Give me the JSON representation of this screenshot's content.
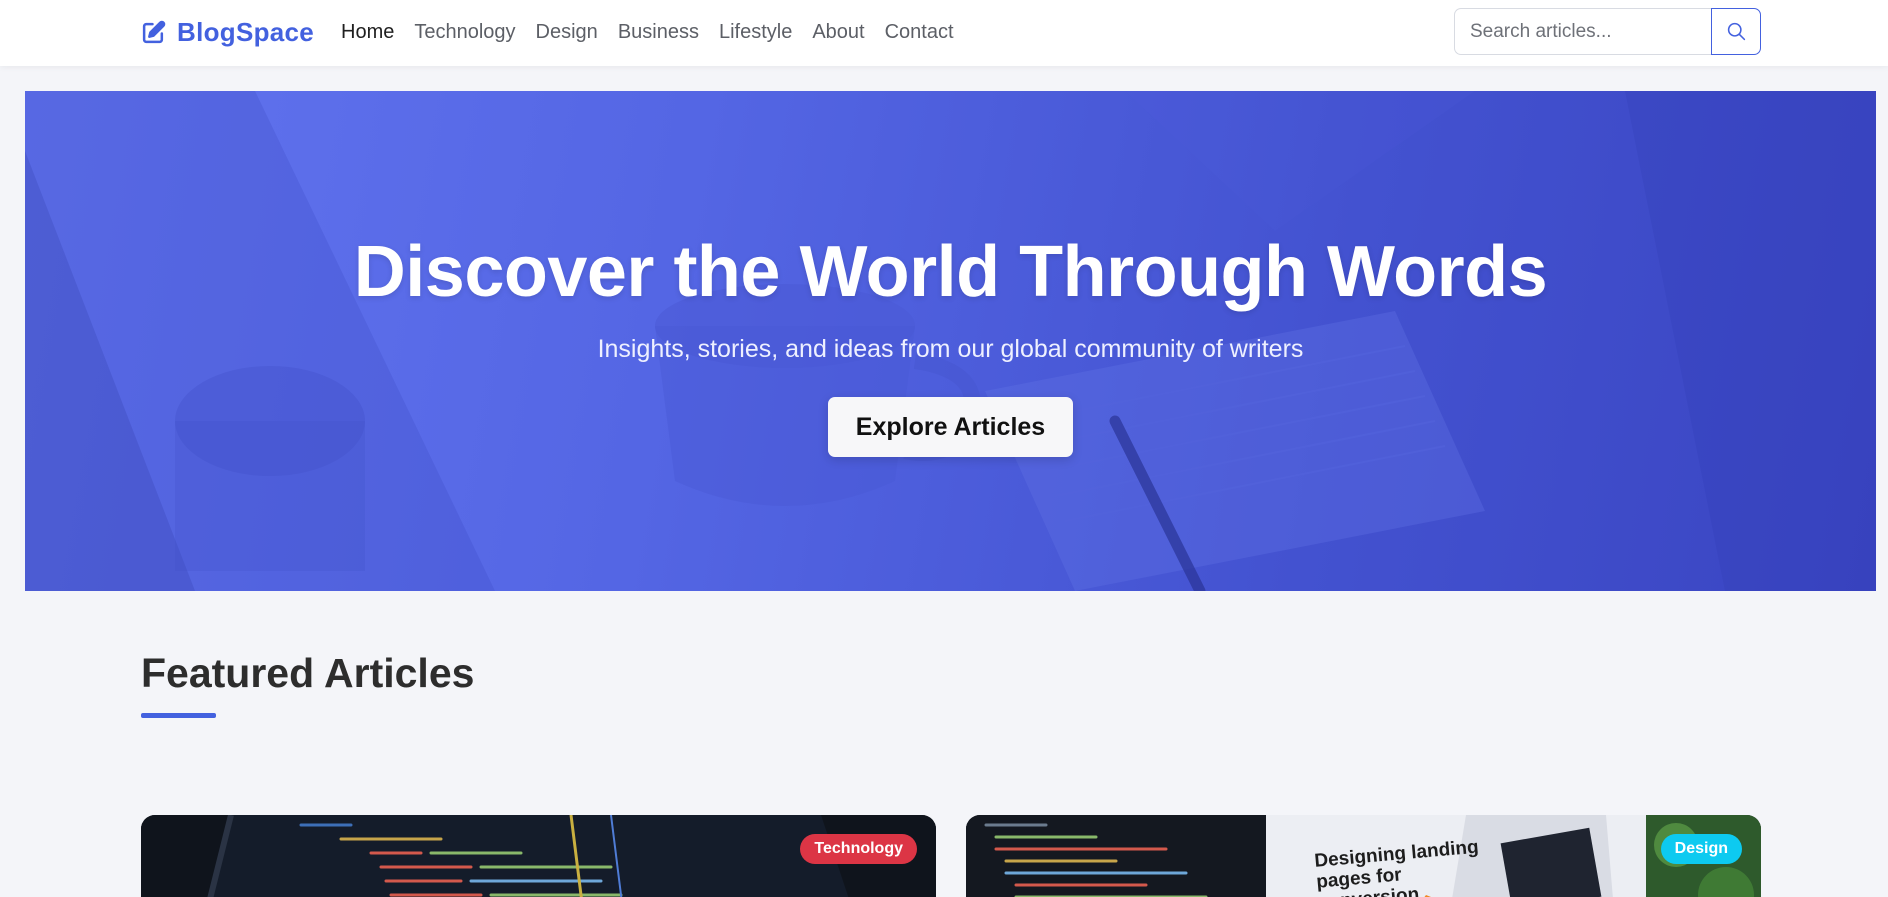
{
  "brand": {
    "name": "BlogSpace",
    "icon": "pencil-square-icon",
    "color": "#4361df"
  },
  "nav": {
    "items": [
      {
        "label": "Home",
        "active": true
      },
      {
        "label": "Technology",
        "active": false
      },
      {
        "label": "Design",
        "active": false
      },
      {
        "label": "Business",
        "active": false
      },
      {
        "label": "Lifestyle",
        "active": false
      },
      {
        "label": "About",
        "active": false
      },
      {
        "label": "Contact",
        "active": false
      }
    ]
  },
  "search": {
    "placeholder": "Search articles...",
    "value": "",
    "icon": "search-icon"
  },
  "hero": {
    "title": "Discover the World Through Words",
    "subtitle": "Insights, stories, and ideas from our global community of writers",
    "cta_label": "Explore Articles"
  },
  "featured": {
    "title": "Featured Articles",
    "cards": [
      {
        "badge": "Technology",
        "badge_color": "#dc3545"
      },
      {
        "badge": "Design",
        "badge_color": "#0dcaf0",
        "image_headline": "Designing landing pages for conversion"
      }
    ]
  },
  "colors": {
    "accent": "#4361df",
    "hero_gradient_start": "#6274ef",
    "hero_gradient_end": "#3a45c2",
    "page_background": "#f4f5f9"
  }
}
